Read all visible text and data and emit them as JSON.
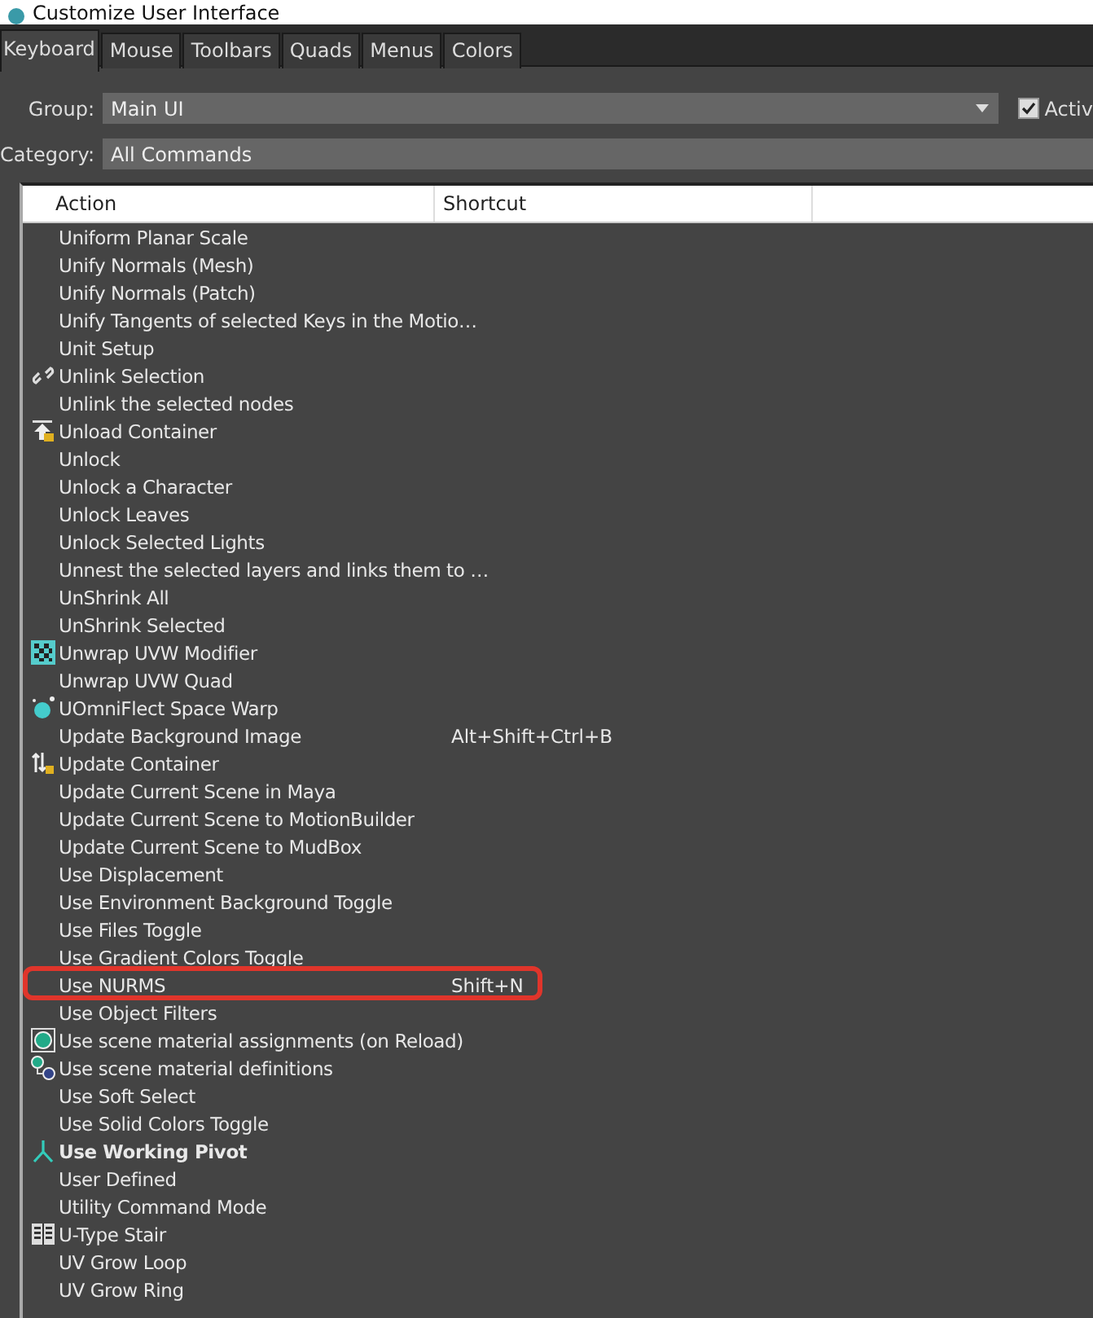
{
  "window": {
    "title": "Customize User Interface"
  },
  "tabs": [
    {
      "label": "Keyboard",
      "selected": true
    },
    {
      "label": "Mouse",
      "selected": false
    },
    {
      "label": "Toolbars",
      "selected": false
    },
    {
      "label": "Quads",
      "selected": false
    },
    {
      "label": "Menus",
      "selected": false
    },
    {
      "label": "Colors",
      "selected": false
    }
  ],
  "group": {
    "label": "Group:",
    "value": "Main UI"
  },
  "active_checkbox": {
    "label": "Activ",
    "checked": true
  },
  "category": {
    "label": "Category:",
    "value": "All Commands"
  },
  "table": {
    "columns": [
      "Action",
      "Shortcut"
    ],
    "rows": [
      {
        "action": "Uniform Planar Scale",
        "kind": "plain",
        "bold": false,
        "highlighted": false
      },
      {
        "action": "Unify Normals (Mesh)",
        "kind": "plain",
        "bold": false,
        "highlighted": false
      },
      {
        "action": "Unify Normals (Patch)",
        "kind": "plain",
        "bold": false,
        "highlighted": false
      },
      {
        "action": "Unify Tangents of selected Keys in the Motio…",
        "kind": "plain",
        "bold": false,
        "highlighted": false
      },
      {
        "action": "Unit Setup",
        "kind": "plain",
        "bold": false,
        "highlighted": false
      },
      {
        "action": "Unlink Selection",
        "kind": "link",
        "bold": false,
        "highlighted": false
      },
      {
        "action": "Unlink the selected nodes",
        "kind": "plain",
        "bold": false,
        "highlighted": false
      },
      {
        "action": "Unload Container",
        "kind": "unload",
        "bold": false,
        "highlighted": false
      },
      {
        "action": "Unlock",
        "kind": "plain",
        "bold": false,
        "highlighted": false
      },
      {
        "action": "Unlock a Character",
        "kind": "plain",
        "bold": false,
        "highlighted": false
      },
      {
        "action": "Unlock Leaves",
        "kind": "plain",
        "bold": false,
        "highlighted": false
      },
      {
        "action": "Unlock Selected Lights",
        "kind": "plain",
        "bold": false,
        "highlighted": false
      },
      {
        "action": "Unnest the selected layers and links them to …",
        "kind": "plain",
        "bold": false,
        "highlighted": false
      },
      {
        "action": "UnShrink All",
        "kind": "plain",
        "bold": false,
        "highlighted": false
      },
      {
        "action": "UnShrink Selected",
        "kind": "plain",
        "bold": false,
        "highlighted": false
      },
      {
        "action": "Unwrap UVW Modifier",
        "kind": "checker",
        "bold": false,
        "highlighted": false
      },
      {
        "action": "Unwrap UVW Quad",
        "kind": "plain",
        "bold": false,
        "highlighted": false
      },
      {
        "action": "UOmniFlect Space Warp",
        "kind": "sphere",
        "bold": false,
        "highlighted": false
      },
      {
        "action": "Update Background Image",
        "shortcut": "Alt+Shift+Ctrl+B",
        "kind": "plain",
        "bold": false,
        "highlighted": false
      },
      {
        "action": "Update Container",
        "kind": "update",
        "bold": false,
        "highlighted": false
      },
      {
        "action": "Update Current Scene in Maya",
        "kind": "plain",
        "bold": false,
        "highlighted": false
      },
      {
        "action": "Update Current Scene to MotionBuilder",
        "kind": "plain",
        "bold": false,
        "highlighted": false
      },
      {
        "action": "Update Current Scene to MudBox",
        "kind": "plain",
        "bold": false,
        "highlighted": false
      },
      {
        "action": "Use Displacement",
        "kind": "plain",
        "bold": false,
        "highlighted": false
      },
      {
        "action": "Use Environment Background Toggle",
        "kind": "plain",
        "bold": false,
        "highlighted": false
      },
      {
        "action": "Use Files Toggle",
        "kind": "plain",
        "bold": false,
        "highlighted": false
      },
      {
        "action": "Use Gradient Colors Toggle",
        "kind": "plain",
        "bold": false,
        "highlighted": false
      },
      {
        "action": "Use NURMS",
        "shortcut": "Shift+N",
        "kind": "plain",
        "bold": false,
        "highlighted": true
      },
      {
        "action": "Use Object Filters",
        "kind": "plain",
        "bold": false,
        "highlighted": false
      },
      {
        "action": "Use scene material assignments (on Reload)",
        "kind": "material",
        "bold": false,
        "highlighted": false
      },
      {
        "action": "Use scene material definitions",
        "kind": "materials",
        "bold": false,
        "highlighted": false
      },
      {
        "action": "Use Soft Select",
        "kind": "plain",
        "bold": false,
        "highlighted": false
      },
      {
        "action": "Use Solid Colors Toggle",
        "kind": "plain",
        "bold": false,
        "highlighted": false
      },
      {
        "action": "Use Working Pivot",
        "kind": "pivot",
        "bold": true,
        "highlighted": false
      },
      {
        "action": "User Defined",
        "kind": "plain",
        "bold": false,
        "highlighted": false
      },
      {
        "action": "Utility Command Mode",
        "kind": "plain",
        "bold": false,
        "highlighted": false
      },
      {
        "action": "U-Type Stair",
        "kind": "stair",
        "bold": false,
        "highlighted": false
      },
      {
        "action": "UV Grow Loop",
        "kind": "plain",
        "bold": false,
        "highlighted": false
      },
      {
        "action": "UV Grow Ring",
        "kind": "plain",
        "bold": false,
        "highlighted": false
      }
    ]
  }
}
